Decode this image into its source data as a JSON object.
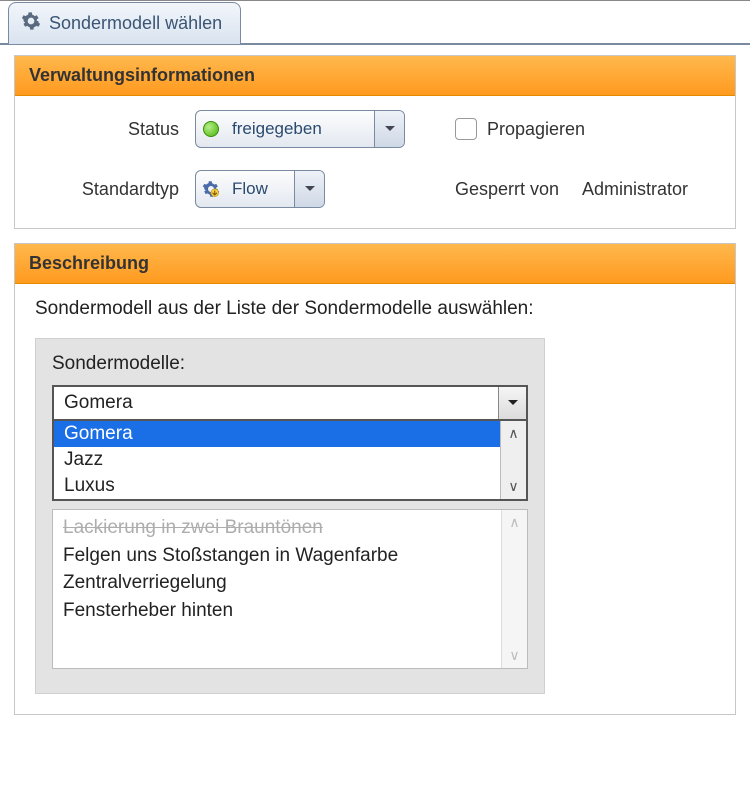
{
  "tab": {
    "label": "Sondermodell wählen"
  },
  "panel1": {
    "title": "Verwaltungsinformationen",
    "status_label": "Status",
    "status_value": "freigegeben",
    "std_label": "Standardtyp",
    "std_value": "Flow",
    "propagate_label": "Propagieren",
    "locked_label": "Gesperrt von",
    "locked_value": "Administrator"
  },
  "panel2": {
    "title": "Beschreibung",
    "intro": "Sondermodell aus der Liste der Sondermodelle auswählen:",
    "list_label": "Sondermodelle:",
    "selected": "Gomera",
    "options": [
      "Gomera",
      "Jazz",
      "Luxus"
    ],
    "details": [
      "Lackierung in zwei Brauntönen",
      "Felgen uns Stoßstangen in Wagenfarbe",
      "Zentralverriegelung",
      "Fensterheber hinten"
    ]
  }
}
